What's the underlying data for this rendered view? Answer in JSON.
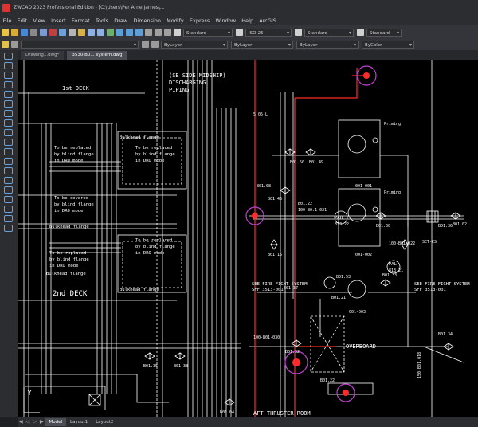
{
  "window": {
    "title": "ZWCAD 2023 Professional Edition - [C:\\Users\\Per Arne Jarnes\\..."
  },
  "menu": [
    "File",
    "Edit",
    "View",
    "Insert",
    "Format",
    "Tools",
    "Draw",
    "Dimension",
    "Modify",
    "Express",
    "Window",
    "Help",
    "ArcGIS"
  ],
  "toolbar": {
    "text_style": "Standard",
    "dim_style": "ISO-25",
    "table_style": "Standard",
    "mleader_style": "Standard",
    "color": "ByLayer",
    "linetype": "ByLayer",
    "lineweight": "ByLayer",
    "plot_style": "ByColor"
  },
  "doc_tabs": [
    "Drawing1.dwg*",
    "3530-B0...  system.dwg"
  ],
  "layout_tabs": [
    "Model",
    "Layout1",
    "Layout2"
  ],
  "drawing": {
    "deck1": "1st DECK",
    "deck2": "2nd DECK",
    "header": [
      "(SB SIDE MIDSHIP)",
      "DISCHARGING",
      "PIPING"
    ],
    "bulkhead1": "Bulkhead flange",
    "replace1": [
      "To be replaced",
      "by blind flange",
      "in DRO mode"
    ],
    "replace_a": [
      "To be replaced",
      "by blind flange",
      "in DRO mode"
    ],
    "covered": [
      "To be covered",
      "by blind flange",
      "in DRO mode"
    ],
    "bulkhead2": "Bulkhead flange",
    "replace_b": [
      "To be replaced",
      "by blind flange",
      "in DRO mode"
    ],
    "replace2": [
      "To be replaced",
      "by blind flange",
      "in DRO mode"
    ],
    "bulkhead3": "Bulkhead flange",
    "bulkhead4": "Bulkhead flange",
    "see_fire1": [
      "SEE FIRE FIGHT SYSTEM",
      "SFF    3513-001"
    ],
    "see_fire2": [
      "SEE FIRE FIGHT SYSTEM",
      "SFF    3513-001"
    ],
    "overboard": "OVERBOARD",
    "thruster": "AFT THRUSTER ROOM",
    "priming1": "Priming",
    "priming2": "Priming",
    "pump_label": "PAH",
    "pump_num": "813.22",
    "pump_label2": "PAL",
    "pump_num2": "813.21",
    "tags": [
      "001-001",
      "001-002",
      "001-003",
      "5.05-L",
      "SET-CS",
      "B01.50",
      "B01.49",
      "B01.46",
      "B01.16",
      "100-B0.1-021",
      "100-B01-030",
      "B01.30",
      "B01.02",
      "B01.33",
      "B01.32",
      "B01.34",
      "B01.35",
      "B01.38",
      "B01.04",
      "B01.22",
      "B01.53",
      "B01.37",
      "B01.21",
      "B01.22",
      "100-B01-022",
      "B01.08",
      "B01.36",
      "150-B01.018"
    ]
  },
  "ucs_label": "Y"
}
